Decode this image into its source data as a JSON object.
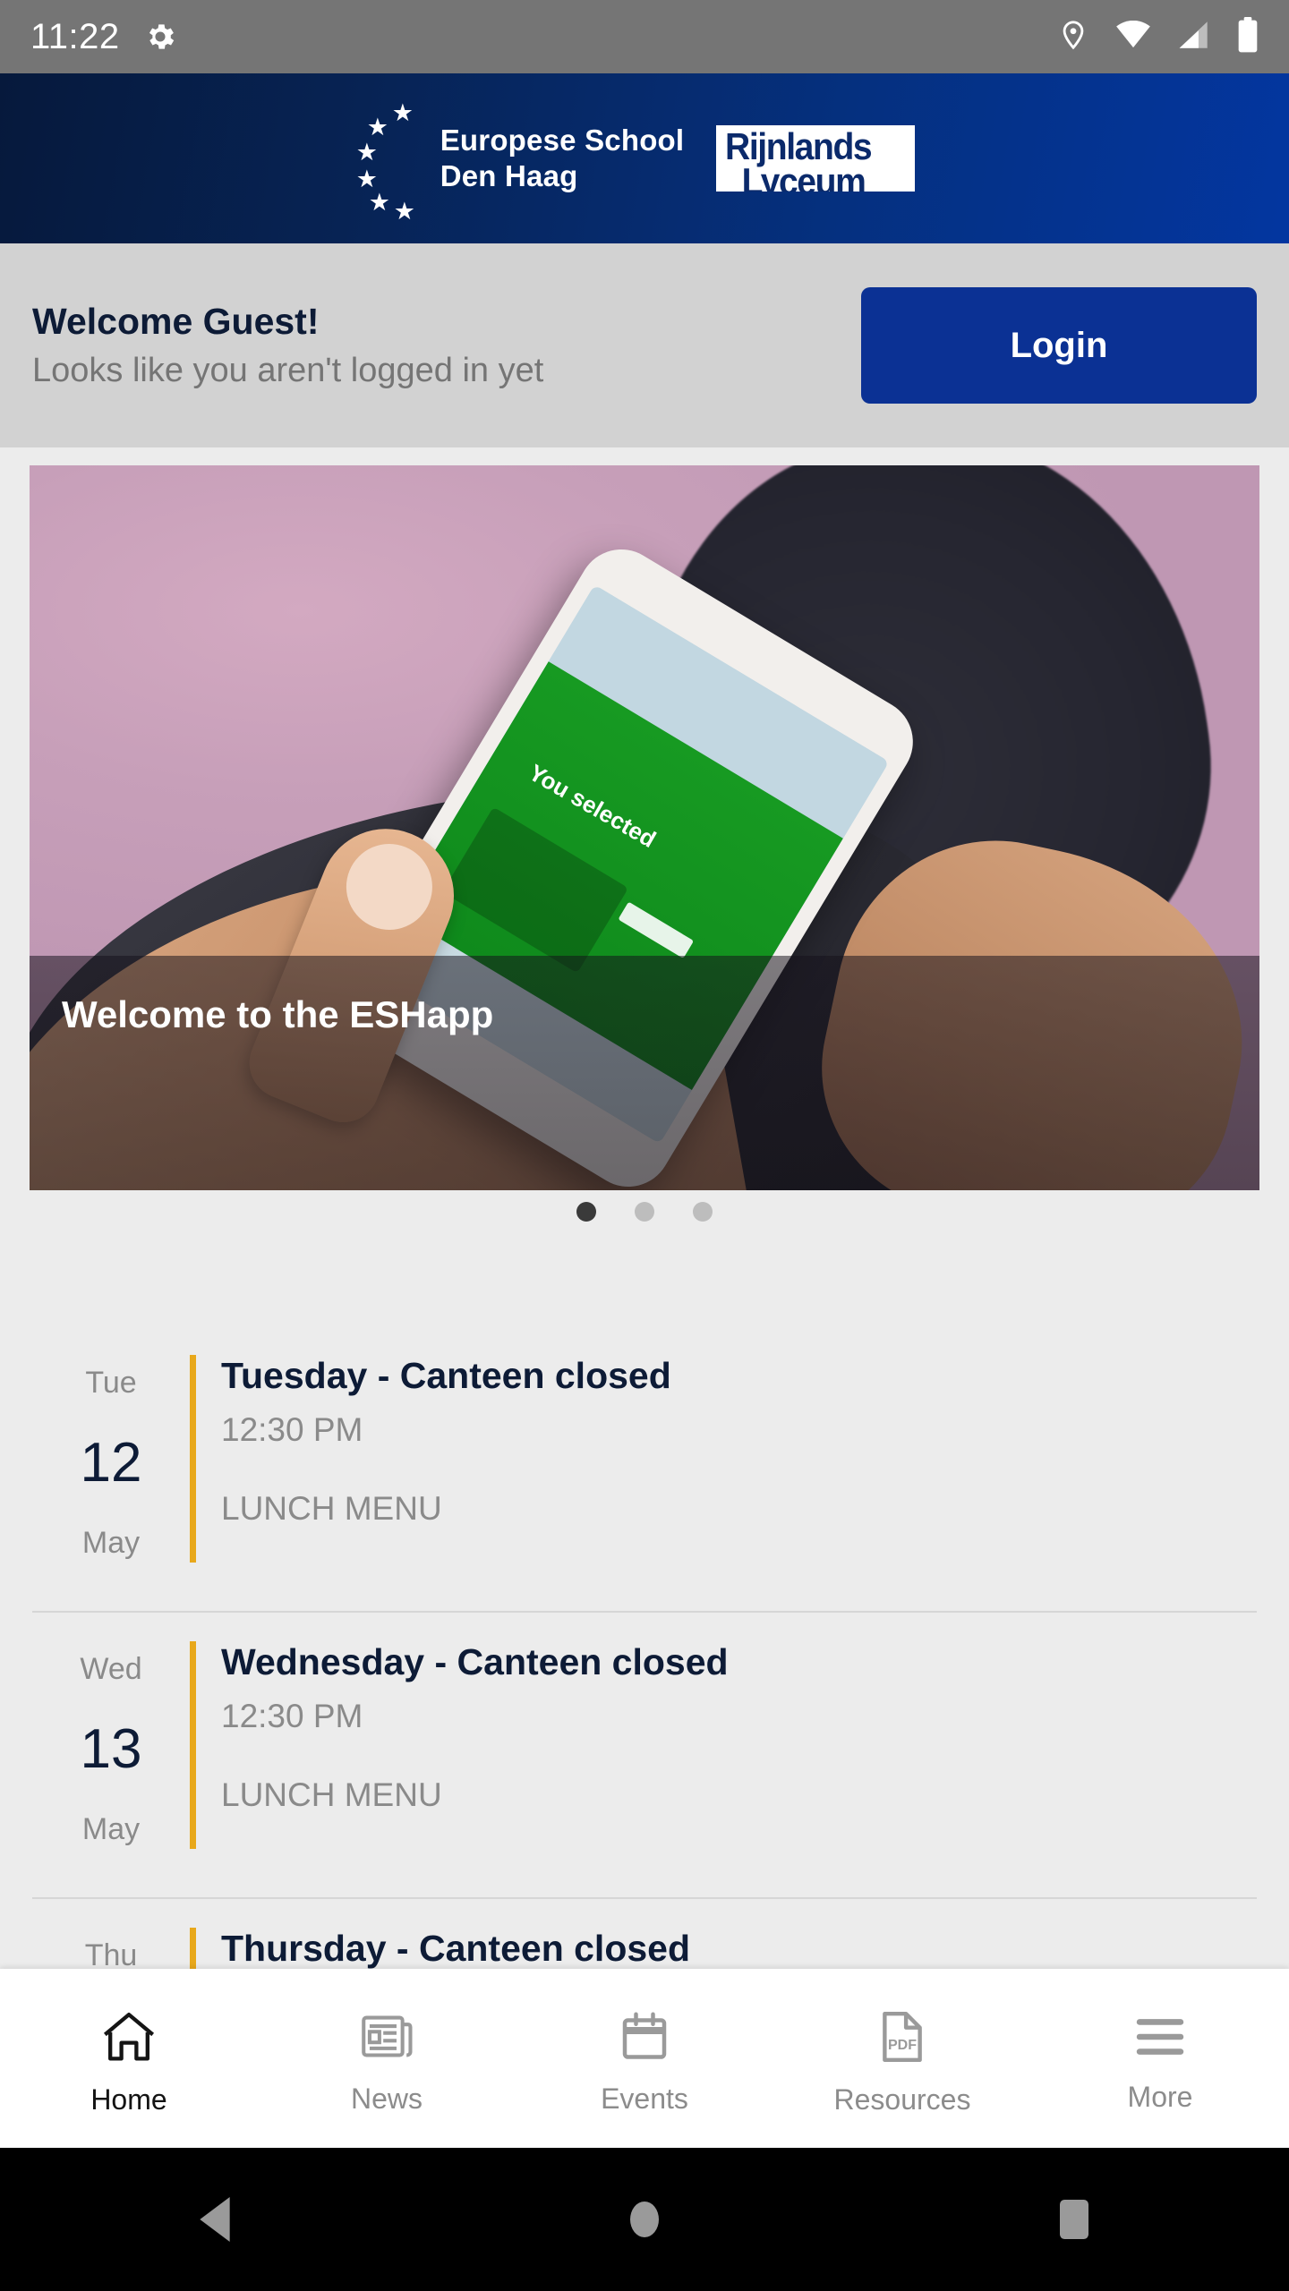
{
  "status_bar": {
    "time": "11:22",
    "icons": [
      "gear-icon",
      "location-pin-icon",
      "wifi-icon",
      "cell-signal-icon",
      "battery-icon"
    ]
  },
  "header": {
    "school_line1": "Europese School",
    "school_line2": "Den Haag",
    "partner_line1": "Rijnlands",
    "partner_line2": "Lyceum",
    "gradient_from": "#06193c",
    "gradient_to": "#0336a0"
  },
  "welcome": {
    "title": "Welcome Guest!",
    "subtitle": "Looks like you aren't logged in yet",
    "login_label": "Login",
    "login_color": "#0b3194",
    "bg_color": "#d2d2d2"
  },
  "carousel": {
    "caption": "Welcome to the ESHapp",
    "slide_count": 3,
    "active_slide": 1,
    "photo_inner_text": "You selected"
  },
  "events": [
    {
      "dow": "Tue",
      "day": "12",
      "month": "May",
      "title": "Tuesday - Canteen closed",
      "time": "12:30 PM",
      "tag": "LUNCH MENU",
      "accent": "#e8a81b"
    },
    {
      "dow": "Wed",
      "day": "13",
      "month": "May",
      "title": "Wednesday - Canteen closed",
      "time": "12:30 PM",
      "tag": "LUNCH MENU",
      "accent": "#e8a81b"
    },
    {
      "dow": "Thu",
      "day": "",
      "month": "",
      "title": "Thursday - Canteen closed",
      "time": "",
      "tag": "",
      "accent": "#e8a81b"
    }
  ],
  "bottom_nav": {
    "active_index": 0,
    "items": [
      {
        "label": "Home",
        "icon": "home-icon"
      },
      {
        "label": "News",
        "icon": "newspaper-icon"
      },
      {
        "label": "Events",
        "icon": "calendar-icon"
      },
      {
        "label": "Resources",
        "icon": "pdf-document-icon"
      },
      {
        "label": "More",
        "icon": "hamburger-menu-icon"
      }
    ]
  },
  "android_nav": {
    "back": "back-triangle-icon",
    "home": "home-circle-icon",
    "recents": "recents-square-icon"
  }
}
